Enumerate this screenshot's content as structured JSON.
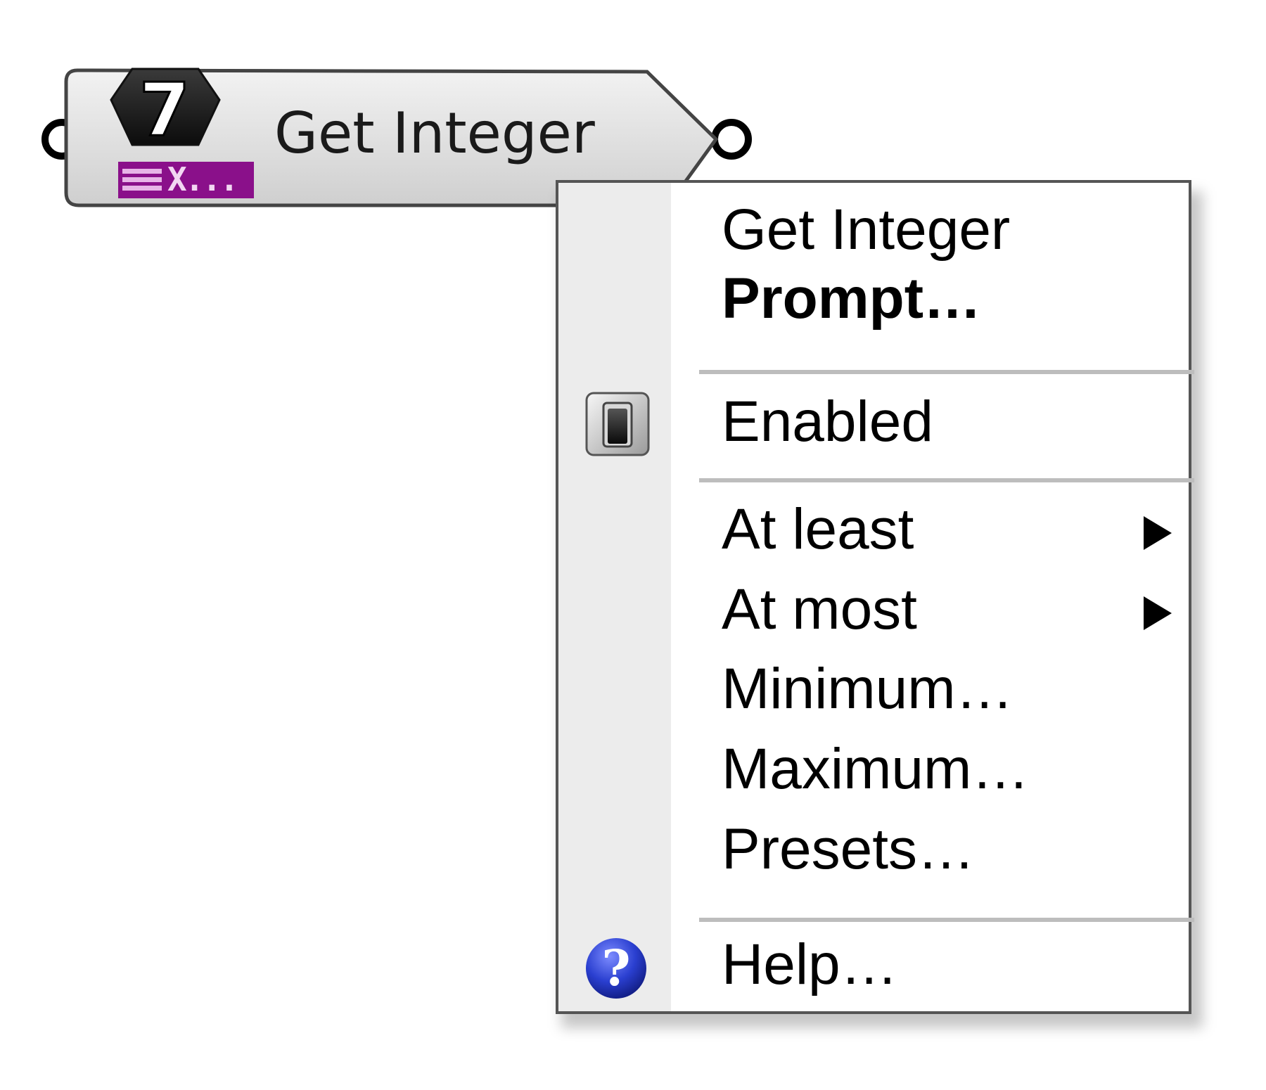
{
  "component": {
    "title": "Get Integer",
    "icon_glyph": "7",
    "icon_tag": "X...",
    "icon": "integer-hex-icon",
    "tag_color": "#8a108a"
  },
  "context_menu": {
    "header_title": "Get Integer",
    "header_action": "Prompt…",
    "enabled_label": "Enabled",
    "enabled_icon": "toggle-switch-icon",
    "at_least_label": "At least",
    "at_most_label": "At most",
    "minimum_label": "Minimum…",
    "maximum_label": "Maximum…",
    "presets_label": "Presets…",
    "help_label": "Help…",
    "help_icon": "help-question-icon",
    "submenu_icon": "chevron-right-icon"
  },
  "colors": {
    "help_blue": "#2a3fd0",
    "gutter": "#ececec",
    "separator": "#bdbdbd"
  }
}
